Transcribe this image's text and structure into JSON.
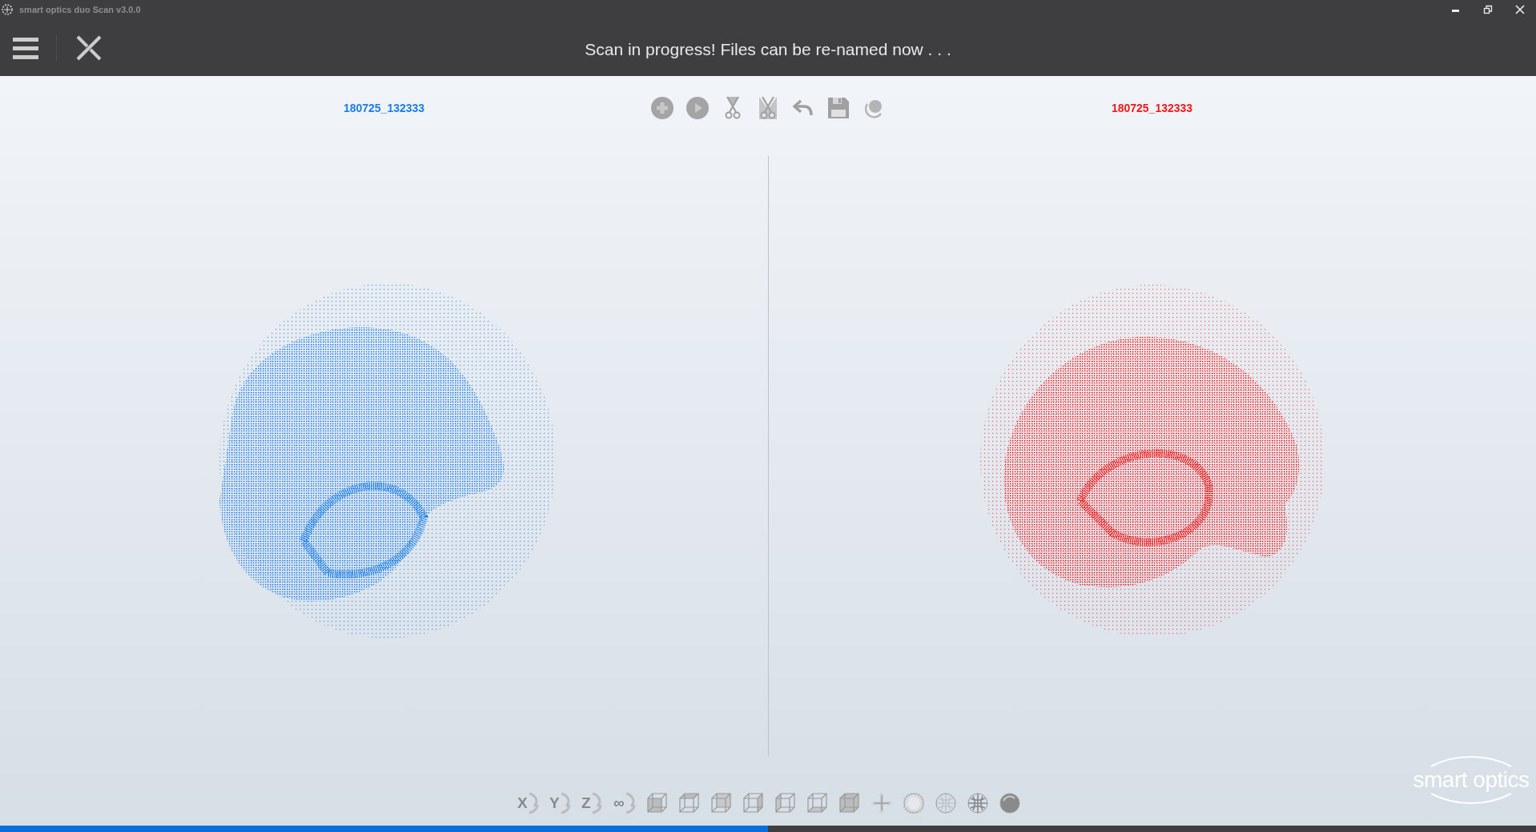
{
  "window": {
    "title": "smart optics duo Scan v3.0.0"
  },
  "header": {
    "message": "Scan in progress! Files can be re-named now . . ."
  },
  "viewports": [
    {
      "label": "180725_132333",
      "color": "#1a7ee8"
    },
    {
      "label": "180725_132333",
      "color": "#f01818"
    }
  ],
  "rotate_buttons": [
    {
      "label": "X"
    },
    {
      "label": "Y"
    },
    {
      "label": "Z"
    },
    {
      "label": "∞"
    }
  ],
  "logo": {
    "text": "smart optics"
  },
  "progress": {
    "level": 0.5
  }
}
